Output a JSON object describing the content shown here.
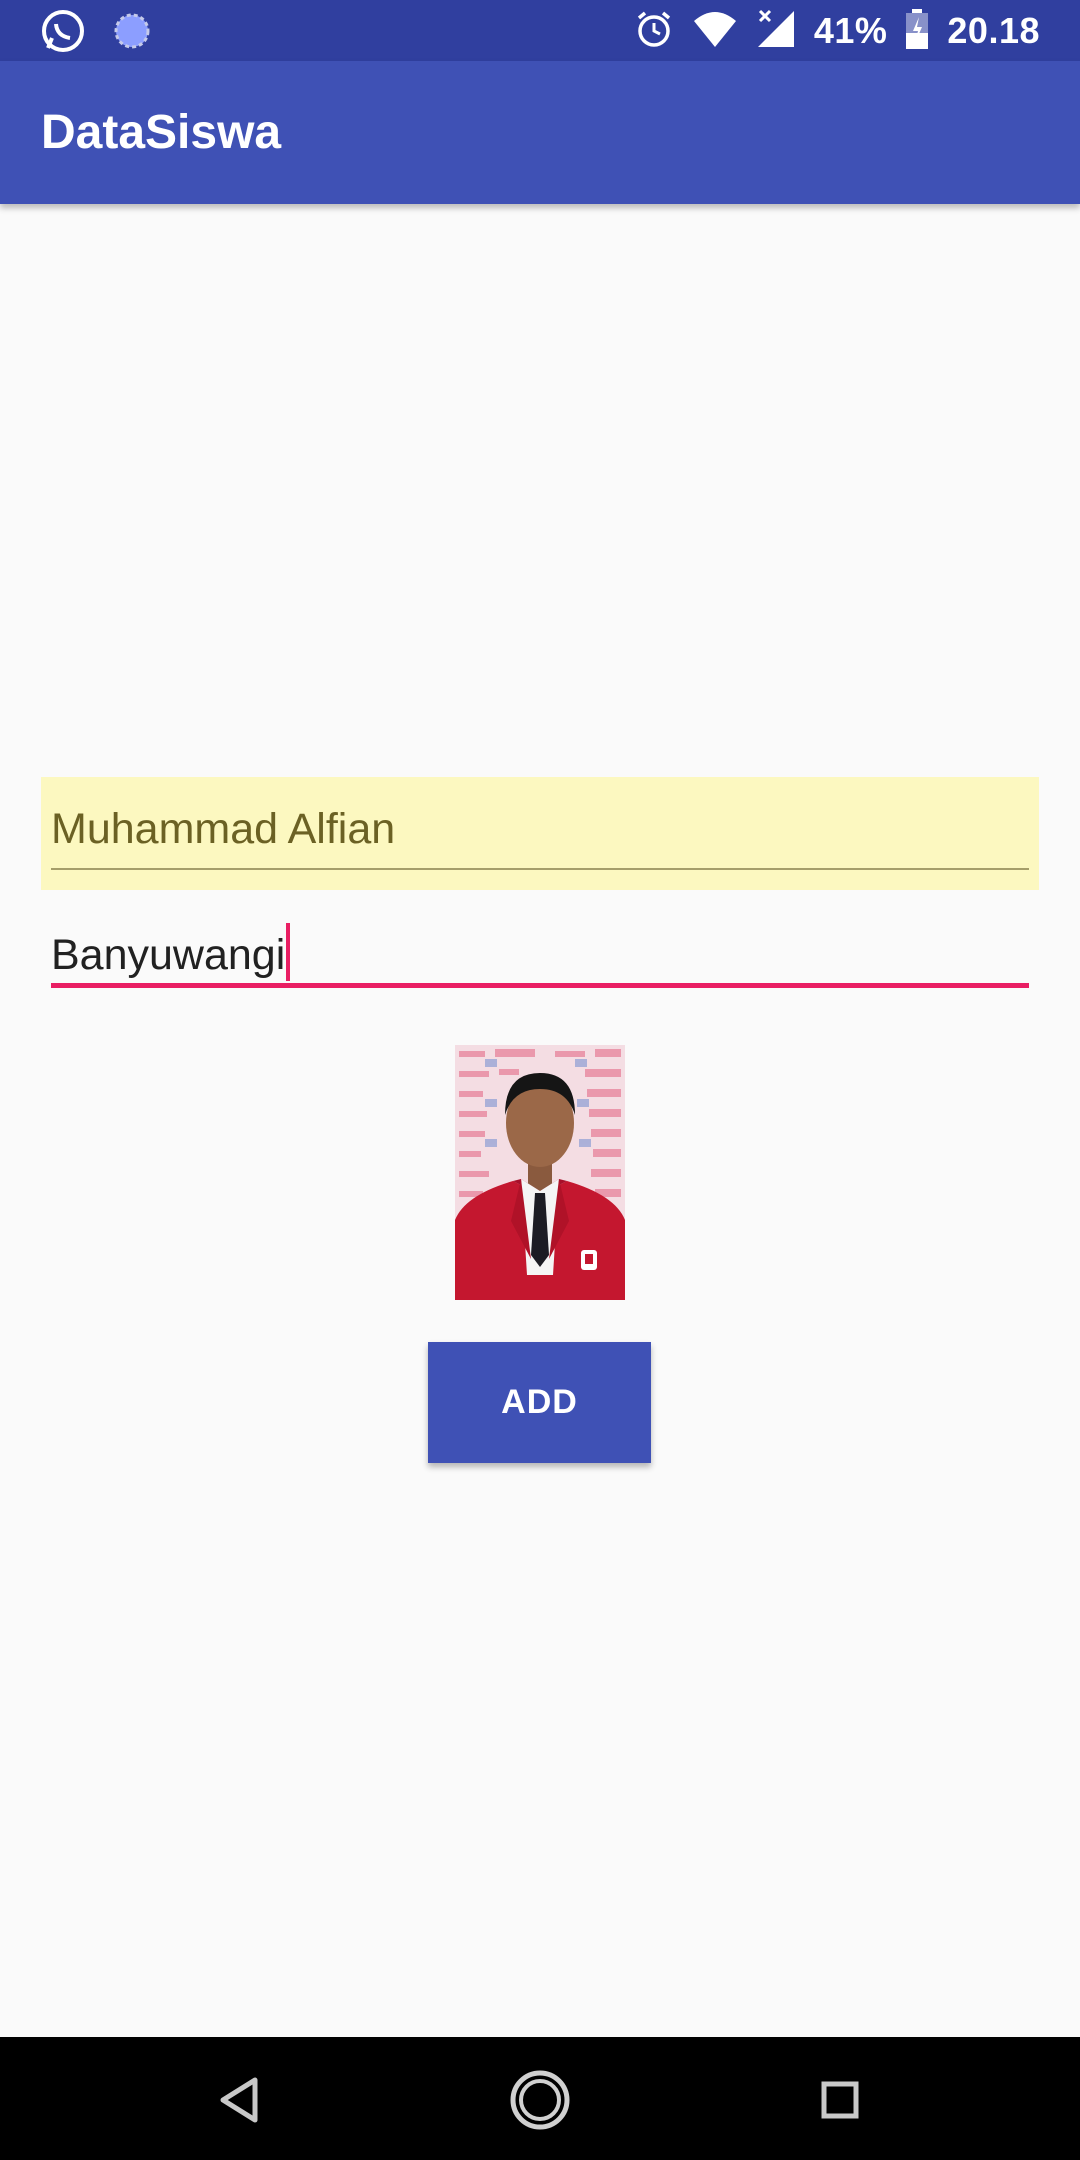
{
  "status_bar": {
    "battery": "41%",
    "time": "20.18",
    "icons": [
      "whatsapp-icon",
      "sync-icon",
      "alarm-icon",
      "wifi-icon",
      "signal-icon",
      "battery-icon"
    ]
  },
  "app_bar": {
    "title": "DataSiswa"
  },
  "form": {
    "name_value": "Muhammad Alfian",
    "city_value": "Banyuwangi",
    "add_label": "ADD"
  },
  "nav_bar": {
    "icons": [
      "back-icon",
      "home-icon",
      "recents-icon"
    ]
  },
  "colors": {
    "primary": "#3f51b5",
    "primary_dark": "#303f9f",
    "accent": "#e91e63",
    "autofill": "#fcf8c0"
  }
}
